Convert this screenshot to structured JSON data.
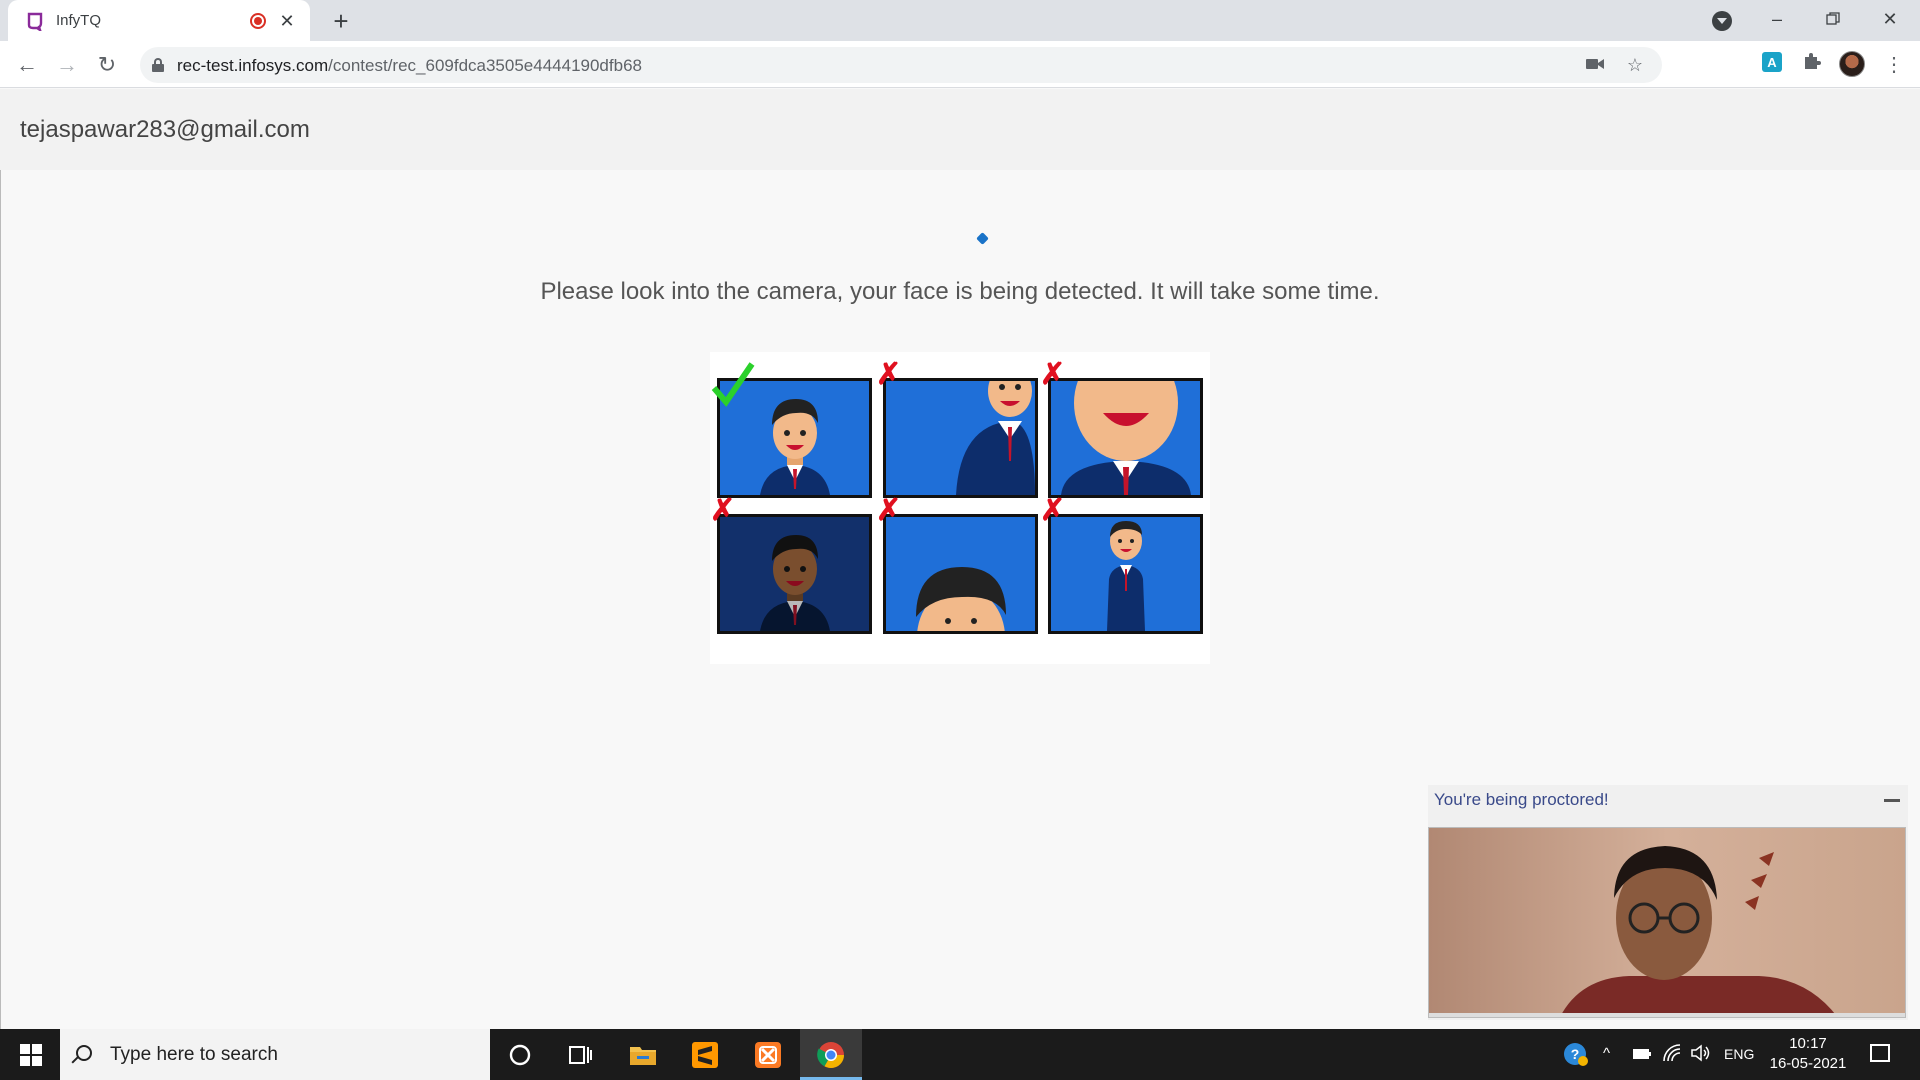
{
  "browser": {
    "tab_title": "InfyTQ",
    "new_tab": "+",
    "url_host": "rec-test.infosys.com",
    "url_path": "/contest/rec_609fdca3505e4444190dfb68"
  },
  "page": {
    "user_email": "tejaspawar283@gmail.com",
    "instruction": "Please look into the camera, your face is being detected. It will take some time."
  },
  "face_examples": [
    {
      "status": "correct"
    },
    {
      "status": "wrong"
    },
    {
      "status": "wrong"
    },
    {
      "status": "wrong"
    },
    {
      "status": "wrong"
    },
    {
      "status": "wrong"
    }
  ],
  "proctor": {
    "title": "You're being proctored!"
  },
  "taskbar": {
    "search_placeholder": "Type here to search",
    "language": "ENG",
    "time": "10:17",
    "date": "16-05-2021"
  },
  "colors": {
    "accent_blue": "#1a73c8",
    "check_green": "#2bd12b",
    "cross_red": "#e0101f",
    "cell_blue": "#1f6fd8"
  }
}
